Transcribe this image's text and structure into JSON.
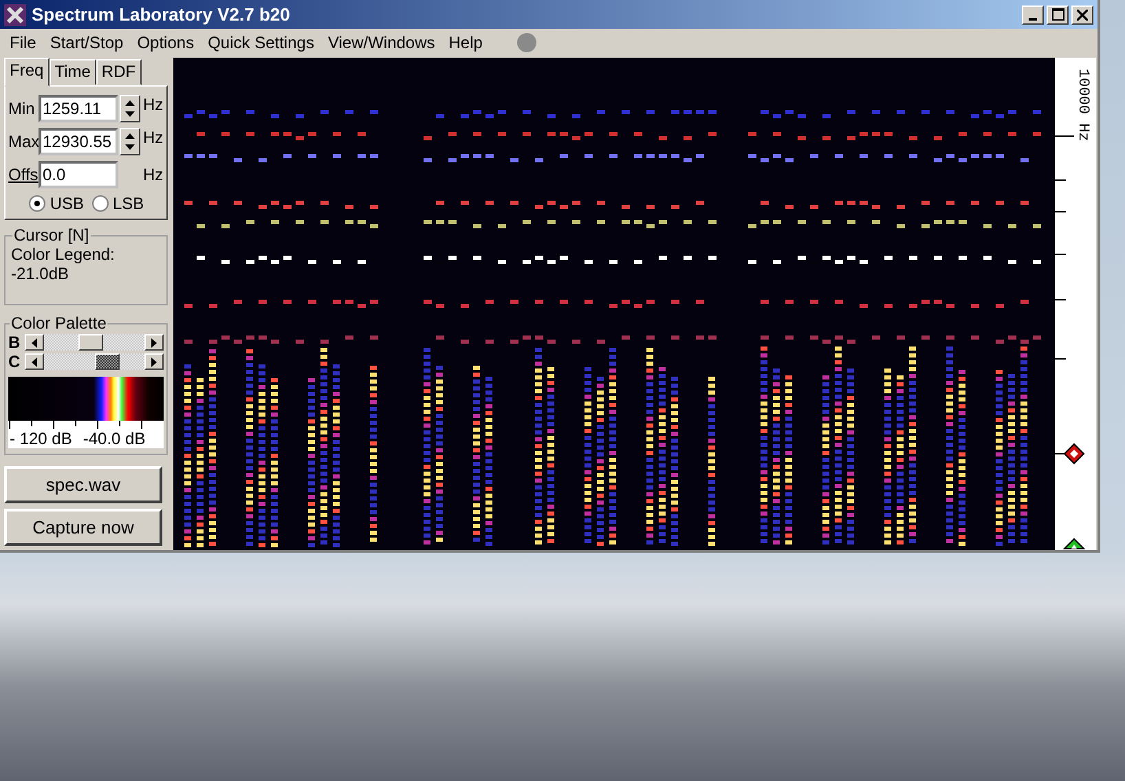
{
  "window": {
    "title": "Spectrum Laboratory V2.7 b20"
  },
  "menu": [
    {
      "label": "File"
    },
    {
      "label": "Start/Stop"
    },
    {
      "label": "Options"
    },
    {
      "label": "Quick Settings"
    },
    {
      "label": "View/Windows"
    },
    {
      "label": "Help"
    }
  ],
  "tabs": [
    {
      "label": "Freq",
      "selected": true
    },
    {
      "label": "Time",
      "selected": false
    },
    {
      "label": "RDF",
      "selected": false
    }
  ],
  "fields": [
    {
      "kind": "spin",
      "label": "Min",
      "value": "1259.11",
      "unit": "Hz"
    },
    {
      "kind": "spin",
      "label": "Max",
      "value": "12930.55",
      "unit": "Hz"
    },
    {
      "kind": "plain",
      "label": "Offs",
      "value": "0.0",
      "unit": "Hz"
    }
  ],
  "sideband": [
    {
      "label": "USB",
      "selected": true
    },
    {
      "label": "LSB",
      "selected": false
    }
  ],
  "cursor": {
    "title": "Cursor [N]",
    "lines": [
      "Color Legend:",
      "-21.0dB"
    ]
  },
  "palette": {
    "title": "Color Palette",
    "sliders": [
      {
        "label": "B",
        "level": 0.45
      },
      {
        "label": "C",
        "level": 0.62
      }
    ],
    "scale": [
      "- 120 dB",
      "-40.0 dB"
    ]
  },
  "buttons": [
    "spec.wav",
    "Capture now"
  ],
  "frequency_axis": {
    "label": "10000 Hz"
  }
}
